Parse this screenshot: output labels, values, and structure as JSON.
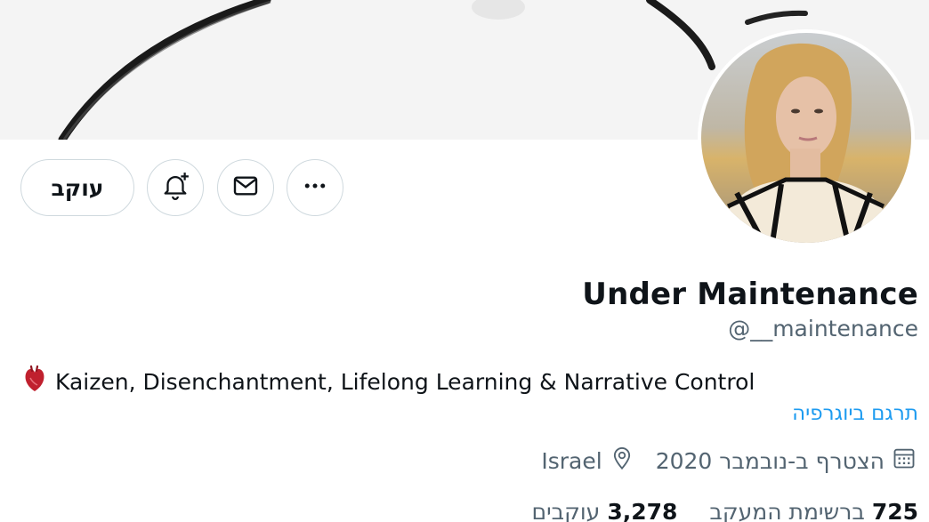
{
  "profile": {
    "display_name": "Under Maintenance",
    "handle": "@__maintenance",
    "bio_emoji": "anatomical-heart-emoji",
    "bio_text": "Kaizen, Disenchantment, Lifelong Learning & Narrative Control",
    "translate_bio": "תרגם ביוגרפיה",
    "location": "Israel",
    "joined": "הצטרף ב-נובמבר 2020"
  },
  "actions": {
    "follow_label": "עוקב",
    "notify_icon": "bell-plus-icon",
    "message_icon": "envelope-icon",
    "more_icon": "more-horizontal-icon"
  },
  "stats": {
    "following_count": "725",
    "following_label": "ברשימת המעקב",
    "followers_count": "3,278",
    "followers_label": "עוקבים"
  },
  "colors": {
    "link": "#1d9bf0",
    "secondary_text": "#536471",
    "border": "#cfd9de"
  }
}
